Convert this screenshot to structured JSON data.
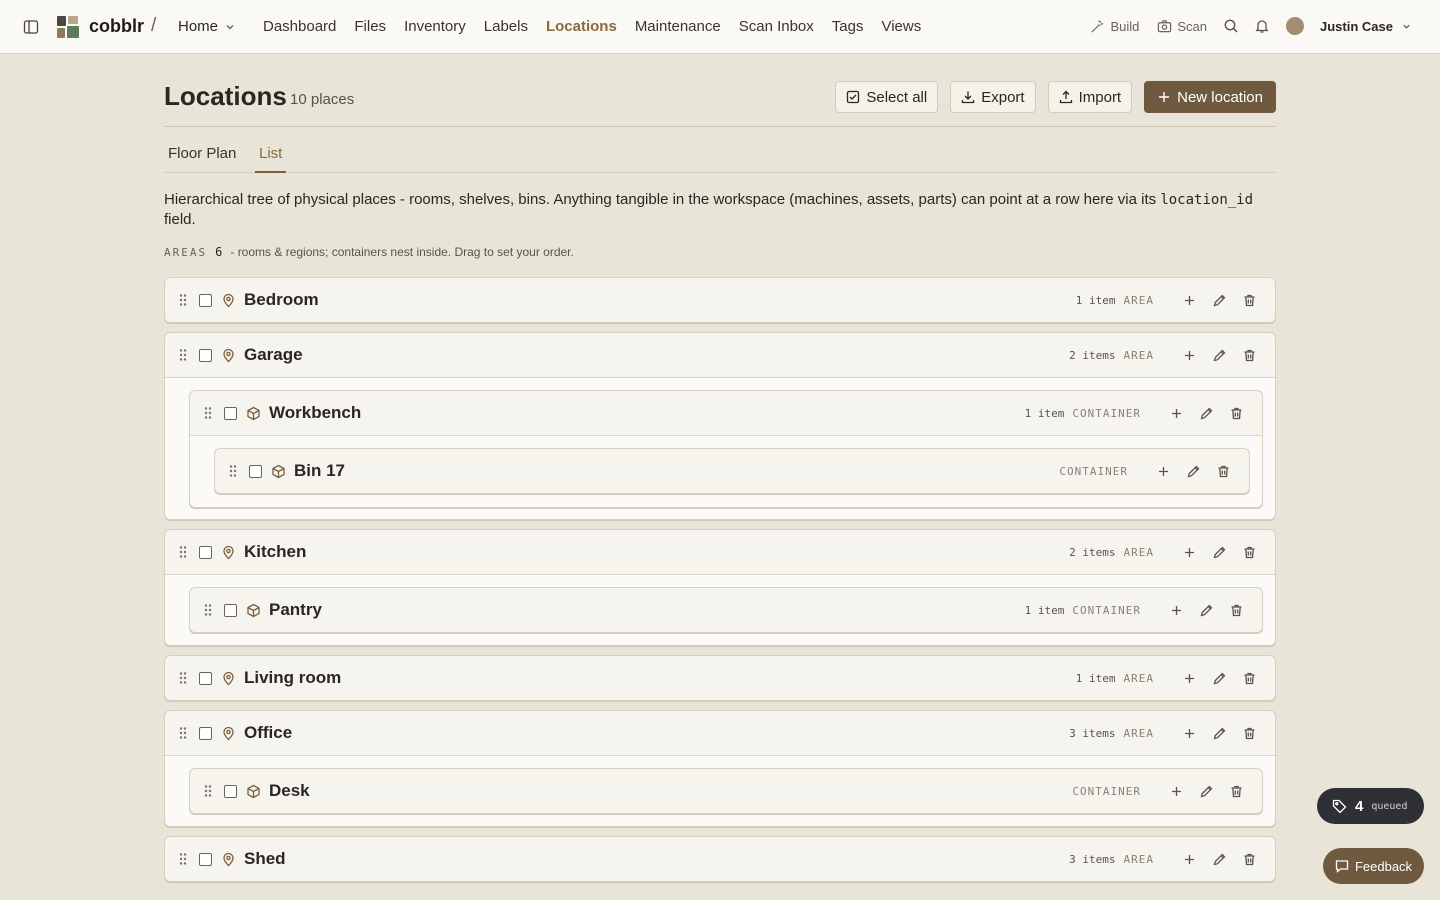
{
  "nav": {
    "brand": "cobblr",
    "separator": "/",
    "workspace": "Home",
    "links": [
      "Dashboard",
      "Files",
      "Inventory",
      "Labels",
      "Locations",
      "Maintenance",
      "Scan Inbox",
      "Tags",
      "Views"
    ],
    "active": "Locations",
    "build_label": "Build",
    "scan_label": "Scan",
    "user_name": "Justin Case"
  },
  "page": {
    "title": "Locations",
    "count": "10 places",
    "actions": {
      "select_all": "Select all",
      "export": "Export",
      "import": "Import",
      "new_location": "New location"
    },
    "tabs": [
      "Floor Plan",
      "List"
    ],
    "active_tab": "List",
    "description_before": "Hierarchical tree of physical places - rooms, shelves, bins. Anything tangible in the workspace (machines, assets, parts) can point at a row here via its ",
    "description_code": "location_id",
    "description_after": " field.",
    "areas_label": "AREAS",
    "areas_count": "6",
    "areas_hint": "- rooms & regions; containers nest inside. Drag to set your order."
  },
  "locations": [
    {
      "name": "Bedroom",
      "count": "1 item",
      "kind": "AREA",
      "icon": "map-pin-icon"
    },
    {
      "name": "Garage",
      "count": "2 items",
      "kind": "AREA",
      "icon": "map-pin-icon"
    },
    {
      "name": "Workbench",
      "count": "1 item",
      "kind": "CONTAINER",
      "icon": "box-icon"
    },
    {
      "name": "Bin 17",
      "count": "",
      "kind": "CONTAINER",
      "icon": "box-icon"
    },
    {
      "name": "Kitchen",
      "count": "2 items",
      "kind": "AREA",
      "icon": "map-pin-icon"
    },
    {
      "name": "Pantry",
      "count": "1 item",
      "kind": "CONTAINER",
      "icon": "box-icon"
    },
    {
      "name": "Living room",
      "count": "1 item",
      "kind": "AREA",
      "icon": "map-pin-icon"
    },
    {
      "name": "Office",
      "count": "3 items",
      "kind": "AREA",
      "icon": "map-pin-icon"
    },
    {
      "name": "Desk",
      "count": "",
      "kind": "CONTAINER",
      "icon": "box-icon"
    },
    {
      "name": "Shed",
      "count": "3 items",
      "kind": "AREA",
      "icon": "map-pin-icon"
    }
  ],
  "queue": {
    "count": "4",
    "label": "queued"
  },
  "feedback_label": "Feedback",
  "colors": {
    "accent": "#8a6a3e",
    "primary_button": "#6f5a3f",
    "background": "#e9e4d8"
  }
}
